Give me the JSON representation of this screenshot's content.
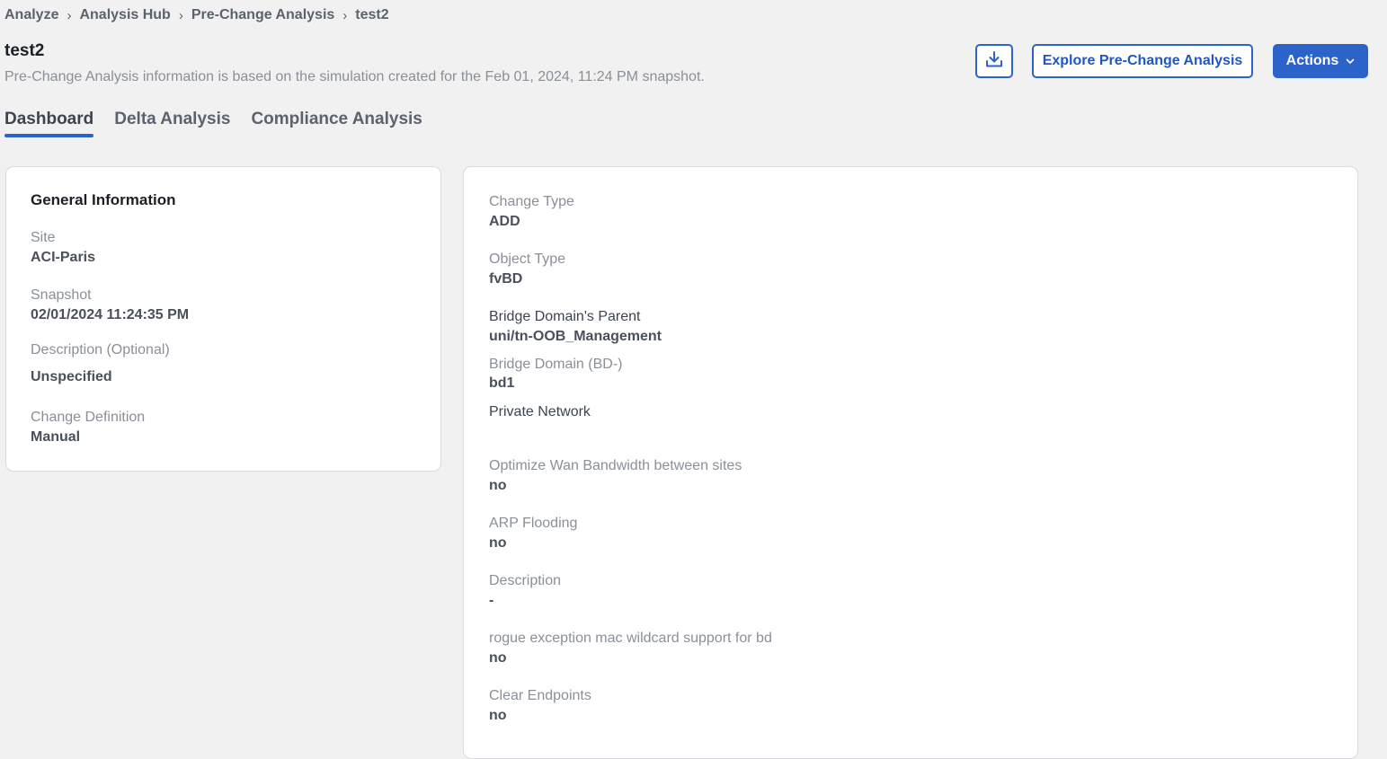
{
  "breadcrumb": {
    "items": [
      "Analyze",
      "Analysis Hub",
      "Pre-Change Analysis",
      "test2"
    ],
    "separator": "›"
  },
  "header": {
    "title": "test2",
    "subtitle": "Pre-Change Analysis information is based on the simulation created for the Feb 01, 2024, 11:24 PM snapshot.",
    "download_icon": "download-icon",
    "explore_label": "Explore Pre-Change Analysis",
    "actions_label": "Actions",
    "actions_icon": "chevron-down-icon"
  },
  "tabs": [
    {
      "label": "Dashboard",
      "active": true
    },
    {
      "label": "Delta Analysis",
      "active": false
    },
    {
      "label": "Compliance Analysis",
      "active": false
    }
  ],
  "general": {
    "title": "General Information",
    "fields": [
      {
        "label": "Site",
        "value": "ACI-Paris"
      },
      {
        "label": "Snapshot",
        "value": "02/01/2024 11:24:35 PM"
      },
      {
        "label": "Description (Optional)",
        "value": "Unspecified"
      },
      {
        "label": "Change Definition",
        "value": "Manual"
      }
    ]
  },
  "details": {
    "fields": [
      {
        "label": "Change Type",
        "value": "ADD"
      },
      {
        "label": "Object Type",
        "value": "fvBD"
      },
      {
        "label": "Bridge Domain's Parent",
        "value": "uni/tn-OOB_Management"
      },
      {
        "label": "Bridge Domain (BD-)",
        "value": "bd1"
      },
      {
        "label": "Private Network",
        "value": ""
      },
      {
        "label": "Optimize Wan Bandwidth between sites",
        "value": "no"
      },
      {
        "label": "ARP Flooding",
        "value": "no"
      },
      {
        "label": "Description",
        "value": "-"
      },
      {
        "label": "rogue exception mac wildcard support for bd",
        "value": "no"
      },
      {
        "label": "Clear Endpoints",
        "value": "no"
      }
    ]
  },
  "colors": {
    "accent": "#2b63c8",
    "background": "#f1f1f1",
    "card": "#ffffff"
  }
}
